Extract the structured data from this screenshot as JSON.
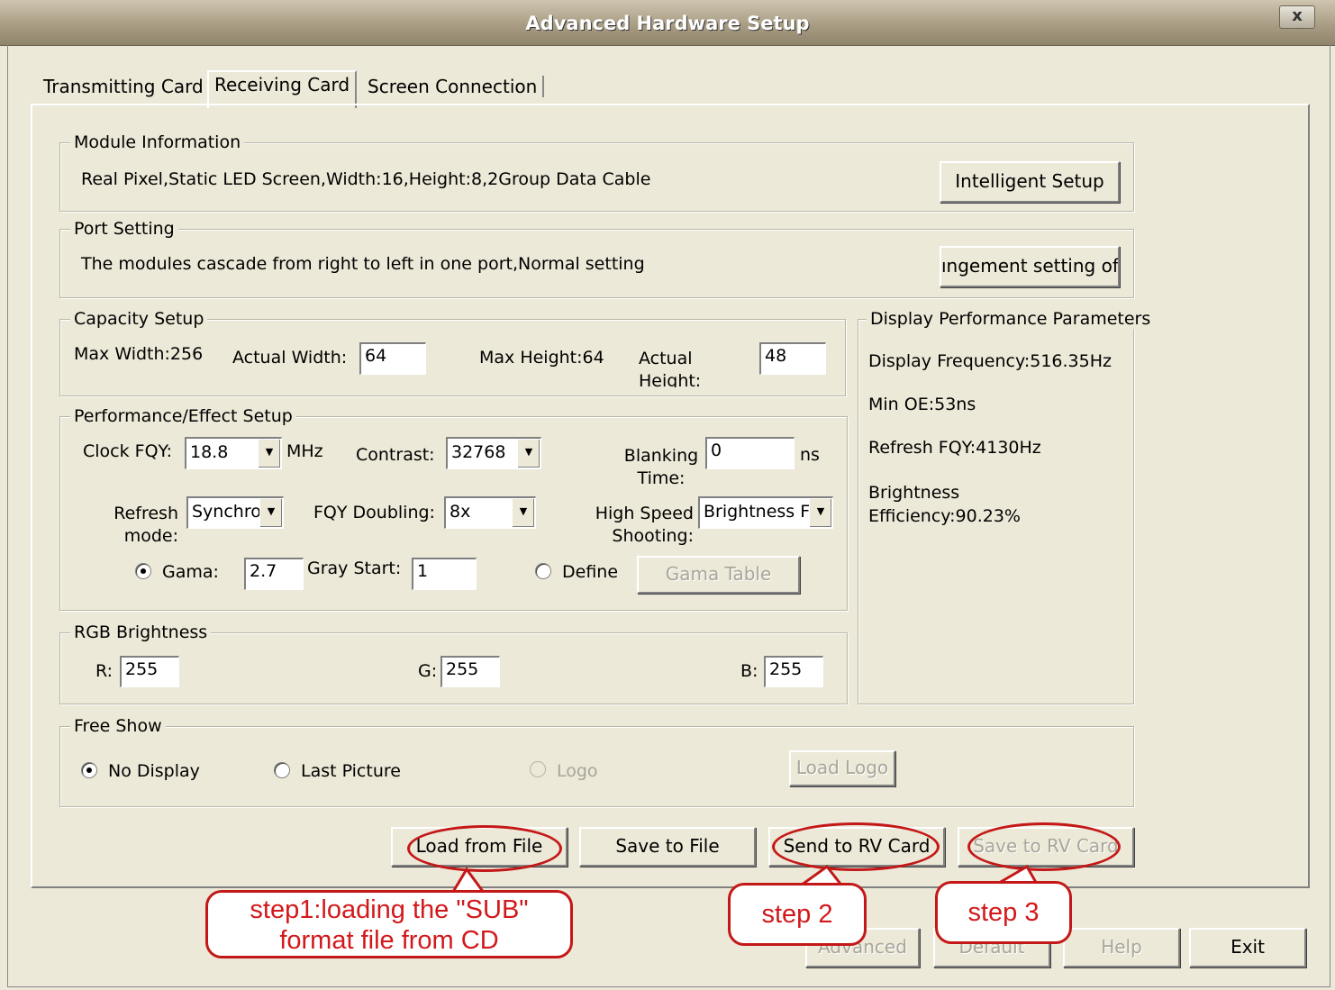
{
  "window": {
    "title": "Advanced Hardware Setup",
    "close_label": "x"
  },
  "tabs": [
    "Transmitting Card",
    "Receiving Card",
    "Screen Connection"
  ],
  "module_info": {
    "title": "Module Information",
    "text": "Real Pixel,Static LED Screen,Width:16,Height:8,2Group Data Cable",
    "button": "Intelligent Setup"
  },
  "port_setting": {
    "title": "Port Setting",
    "text": "The modules cascade from right to left in one port,Normal setting",
    "button": "ıngement setting of"
  },
  "capacity": {
    "title": "Capacity Setup",
    "max_width": "Max Width:256",
    "actual_width_label": "Actual Width:",
    "actual_width_value": "64",
    "max_height": "Max Height:64",
    "actual_height_label": "Actual Height:",
    "actual_height_value": "48"
  },
  "performance": {
    "title": "Performance/Effect Setup",
    "clock_label": "Clock FQY:",
    "clock_value": "18.8",
    "clock_unit": "MHz",
    "contrast_label": "Contrast:",
    "contrast_value": "32768",
    "blanking_label": "Blanking Time:",
    "blanking_value": "0",
    "blanking_unit": "ns",
    "refresh_label": "Refresh mode:",
    "refresh_value": "Synchro",
    "fqy_doubling_label": "FQY Doubling:",
    "fqy_doubling_value": "8x",
    "high_speed_label": "High Speed Shooting:",
    "high_speed_value": "Brightness F",
    "gama_label": "Gama:",
    "gama_value": "2.7",
    "gray_start_label": "Gray Start:",
    "gray_start_value": "1",
    "define_label": "Define",
    "gama_table_button": "Gama Table"
  },
  "rgb": {
    "title": "RGB Brightness",
    "r_label": "R:",
    "r_value": "255",
    "g_label": "G:",
    "g_value": "255",
    "b_label": "B:",
    "b_value": "255"
  },
  "display_params": {
    "title": "Display Performance Parameters",
    "frequency": "Display Frequency:516.35Hz",
    "min_oe": "Min OE:53ns",
    "refresh": "Refresh FQY:4130Hz",
    "brightness_label": "Brightness",
    "brightness_value": "Efficiency:90.23%"
  },
  "free_show": {
    "title": "Free Show",
    "no_display": "No Display",
    "last_picture": "Last Picture",
    "logo": "Logo",
    "load_logo": "Load Logo"
  },
  "actions": {
    "load_from_file": "Load from File",
    "save_to_file": "Save to File",
    "send_to_rv": "Send to RV Card",
    "save_to_rv": "Save to RV Card"
  },
  "bottom_buttons": {
    "advanced": "Advanced",
    "default": "Default",
    "help": "Help",
    "exit": "Exit"
  },
  "annotations": {
    "step1_line1": "step1:loading the \"SUB\"",
    "step1_line2": "format file from CD",
    "step2": "step 2",
    "step3": "step 3",
    "color": "#d2191b"
  }
}
